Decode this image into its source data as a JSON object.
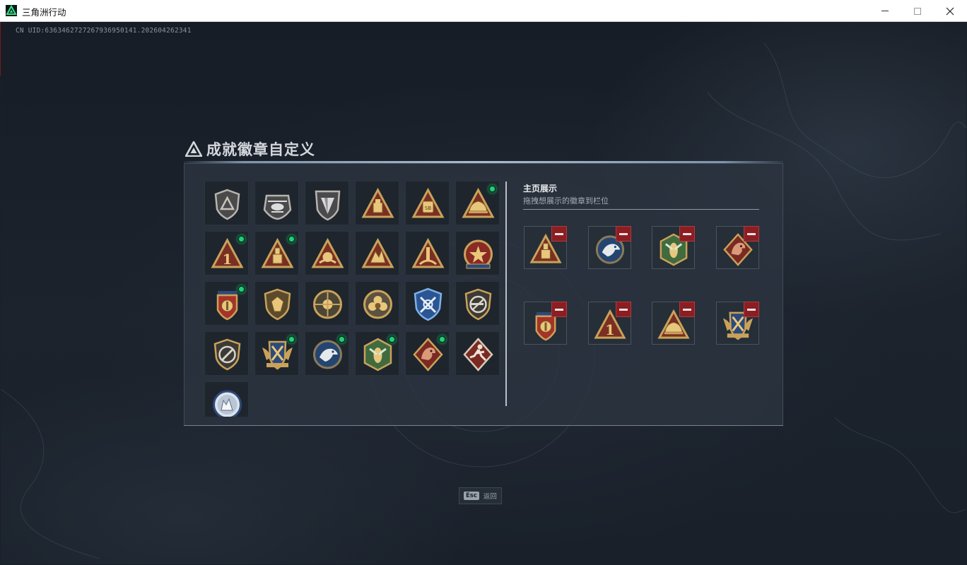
{
  "window": {
    "title": "三角洲行动",
    "controls": [
      "minimize",
      "maximize",
      "close"
    ]
  },
  "uid_text": "CN UID:6363462727267936950141.202604262341",
  "panel": {
    "title": "成就徽章自定义",
    "icon": "delta-logo-icon"
  },
  "badge_grid": {
    "rows": [
      [
        {
          "icon": "shield-triangle-badge",
          "new": false
        },
        {
          "icon": "helicopter-badge",
          "new": false
        },
        {
          "icon": "arrowhead-shield-badge",
          "new": false
        },
        {
          "icon": "gold-triangle-box-badge",
          "new": false
        },
        {
          "icon": "gold-triangle-sb-badge",
          "new": false
        },
        {
          "icon": "gold-triangle-helmet-badge",
          "new": true
        }
      ],
      [
        {
          "icon": "gold-triangle-number-one-badge",
          "new": true
        },
        {
          "icon": "gold-triangle-tower-badge",
          "new": true
        },
        {
          "icon": "gold-triangle-hand-badge",
          "new": false
        },
        {
          "icon": "gold-triangle-dragon-badge",
          "new": false
        },
        {
          "icon": "gold-triangle-rocket-badge",
          "new": false
        },
        {
          "icon": "star-emblem-badge",
          "new": false
        }
      ],
      [
        {
          "icon": "gold-crest-shield-badge",
          "new": true
        },
        {
          "icon": "gold-gem-shield-badge",
          "new": false
        },
        {
          "icon": "crosshair-skull-badge",
          "new": false
        },
        {
          "icon": "gold-flower-badge",
          "new": false
        },
        {
          "icon": "blue-crossed-shield-badge",
          "new": false
        },
        {
          "icon": "rifle-no-shield-badge",
          "new": false
        }
      ],
      [
        {
          "icon": "knife-no-shield-badge",
          "new": false
        },
        {
          "icon": "winged-gold-shield-badge",
          "new": true
        },
        {
          "icon": "blue-eagle-badge",
          "new": true
        },
        {
          "icon": "green-wasp-badge",
          "new": true
        },
        {
          "icon": "red-dragon-badge",
          "new": true
        },
        {
          "icon": "red-runner-badge",
          "new": false
        }
      ],
      [
        {
          "icon": "blue-wolf-badge",
          "new": false
        }
      ]
    ]
  },
  "showcase": {
    "title": "主页展示",
    "subtitle": "拖拽想展示的徽章到栏位",
    "slots": [
      {
        "icon": "gold-triangle-tower-badge"
      },
      {
        "icon": "blue-eagle-badge"
      },
      {
        "icon": "green-wasp-badge"
      },
      {
        "icon": "red-dragon-badge"
      },
      {
        "icon": "gold-crest-shield-badge"
      },
      {
        "icon": "gold-triangle-number-one-badge"
      },
      {
        "icon": "gold-triangle-helmet-badge"
      },
      {
        "icon": "winged-gold-shield-badge"
      }
    ]
  },
  "esc_hint": {
    "key": "Esc",
    "label": "返回"
  },
  "colors": {
    "new_dot": "#1fd07a",
    "remove_button": "#8b1e22",
    "gold": "#c9a25a",
    "panel_bg": "#2c3540"
  }
}
